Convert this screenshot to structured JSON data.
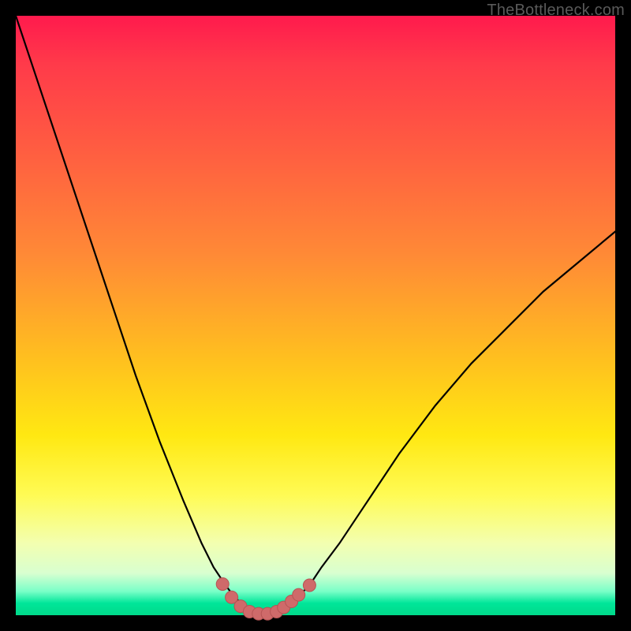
{
  "watermark": "TheBottleneck.com",
  "colors": {
    "curve_stroke": "#000000",
    "dots_fill": "#cf6a6a",
    "dots_stroke": "#b65454"
  },
  "chart_data": {
    "type": "line",
    "title": "",
    "xlabel": "",
    "ylabel": "",
    "xlim": [
      0,
      100
    ],
    "ylim": [
      0,
      100
    ],
    "x": [
      0,
      4,
      8,
      12,
      16,
      20,
      24,
      28,
      31,
      33,
      35,
      36.5,
      38,
      39,
      40,
      41,
      42,
      43,
      44,
      45.5,
      47,
      49,
      51,
      54,
      58,
      64,
      70,
      76,
      82,
      88,
      94,
      100
    ],
    "values": [
      100,
      88,
      76,
      64,
      52,
      40,
      29,
      19,
      12,
      8,
      5,
      3,
      1.7,
      1,
      0.5,
      0.2,
      0.2,
      0.4,
      0.9,
      1.8,
      3,
      5,
      8,
      12,
      18,
      27,
      35,
      42,
      48,
      54,
      59,
      64
    ],
    "dots": [
      {
        "x": 34.5,
        "y": 5.2
      },
      {
        "x": 36.0,
        "y": 3.0
      },
      {
        "x": 37.5,
        "y": 1.5
      },
      {
        "x": 39.0,
        "y": 0.6
      },
      {
        "x": 40.5,
        "y": 0.25
      },
      {
        "x": 42.0,
        "y": 0.25
      },
      {
        "x": 43.5,
        "y": 0.6
      },
      {
        "x": 44.7,
        "y": 1.3
      },
      {
        "x": 46.0,
        "y": 2.3
      },
      {
        "x": 47.2,
        "y": 3.4
      },
      {
        "x": 49.0,
        "y": 5.0
      }
    ],
    "dot_radius_px": 8
  }
}
